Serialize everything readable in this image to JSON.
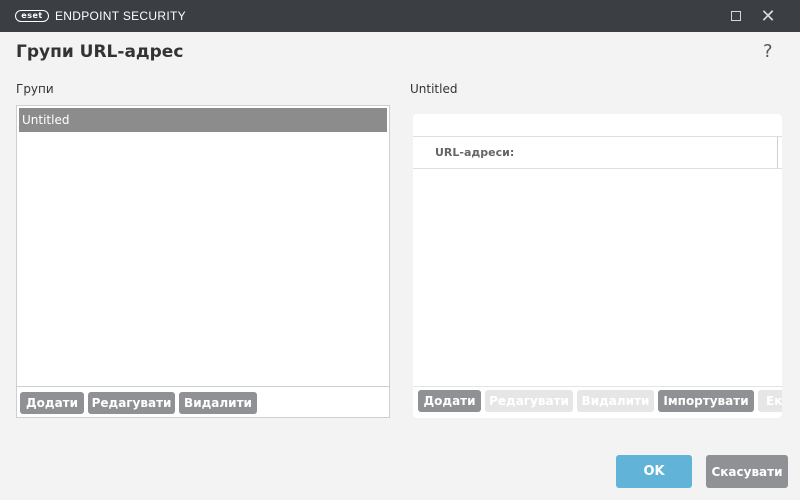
{
  "window": {
    "logo_text": "eset",
    "product_name": "ENDPOINT SECURITY",
    "minimize_glyph": "☐",
    "close_glyph": "✕"
  },
  "dialog": {
    "title": "Групи URL-адрес",
    "help_glyph": "?"
  },
  "groups_panel": {
    "label": "Групи",
    "items": [
      "Untitled"
    ],
    "buttons": {
      "add": "Додати",
      "edit": "Редагувати",
      "delete": "Видалити"
    }
  },
  "detail_panel": {
    "label": "Untitled",
    "column_header": "URL-адреси:",
    "buttons": {
      "add": "Додати",
      "edit": "Редагувати",
      "delete": "Видалити",
      "import": "Імпортувати",
      "export": "Екс"
    }
  },
  "footer": {
    "ok": "OK",
    "cancel": "Скасувати"
  },
  "colors": {
    "titlebar": "#3b3e42",
    "accent": "#62b3d8",
    "button_gray": "#8f9194",
    "selection": "#8c8c8c"
  }
}
